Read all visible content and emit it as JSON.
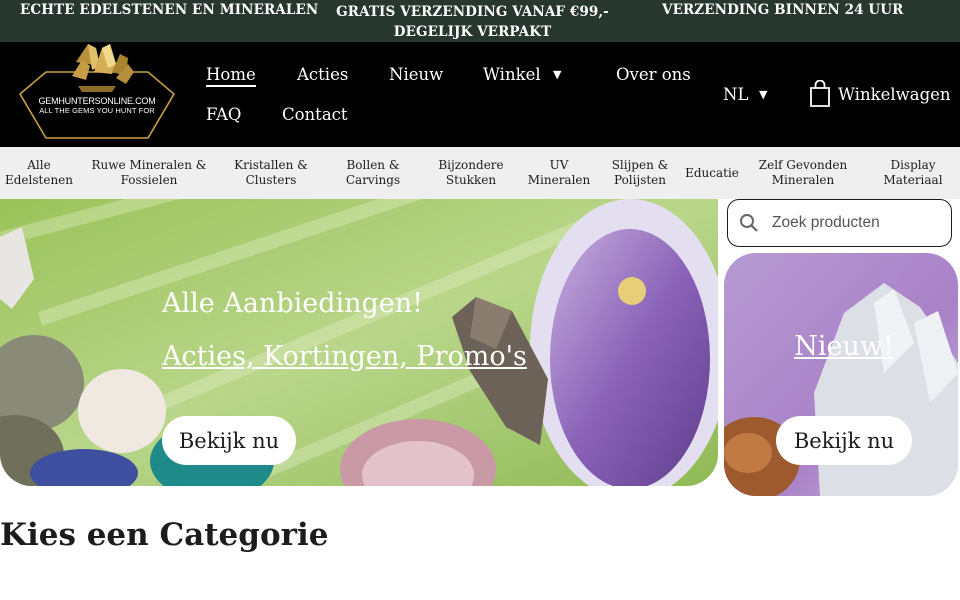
{
  "announcement": {
    "left": "ECHTE EDELSTENEN EN MINERALEN",
    "center": "GRATIS VERZENDING VANAF €99,- DEGELIJK VERPAKT",
    "right": "VERZENDING BINNEN 24 UUR"
  },
  "logo": {
    "name": "GEMHUNTERSONLINE.COM",
    "tagline": "ALL THE GEMS YOU HUNT FOR"
  },
  "nav": {
    "home": "Home",
    "acties": "Acties",
    "nieuw": "Nieuw",
    "winkel": "Winkel",
    "over_ons": "Over ons",
    "faq": "FAQ",
    "contact": "Contact",
    "language": "NL",
    "cart": "Winkelwagen"
  },
  "categories": [
    "Alle Edelstenen",
    "Ruwe Mineralen & Fossielen",
    "Kristallen & Clusters",
    "Bollen & Carvings",
    "Bijzondere Stukken",
    "UV Mineralen",
    "Slijpen & Polijsten",
    "Educatie",
    "Zelf Gevonden Mineralen",
    "Display Materiaal"
  ],
  "hero": {
    "title": "Alle Aanbiedingen!",
    "link": "Acties, Kortingen, Promo's",
    "button": "Bekijk nu"
  },
  "side_banner": {
    "link": "Nieuw!",
    "button": "Bekijk nu"
  },
  "search": {
    "placeholder": "Zoek producten"
  },
  "section": {
    "title": "Kies een Categorie"
  },
  "colors": {
    "announcement_bg": "#27372d",
    "header_bg": "#000000",
    "category_bar_bg": "#efefef",
    "logo_gold": "#c9a043"
  },
  "icons": [
    "crystal-logo-icon",
    "chevron-down-icon",
    "shopping-bag-icon",
    "search-icon"
  ]
}
